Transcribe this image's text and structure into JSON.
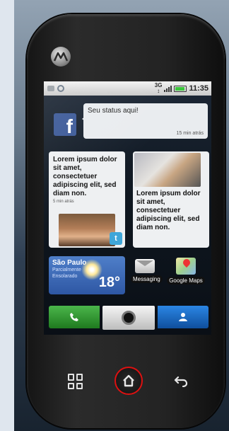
{
  "statusbar": {
    "network": "3G",
    "time": "11:35"
  },
  "facebook": {
    "icon_letter": "f",
    "status": "Seu status aqui!",
    "time": "15 min atrás"
  },
  "social": [
    {
      "text": "Lorem ipsum dolor sit amet, consectetuer adipiscing elit, sed diam non.",
      "time": "5 min atrás",
      "badge": "t"
    },
    {
      "text": "Lorem ipsum dolor sit amet, consectetuer adipiscing elit, sed diam non."
    }
  ],
  "weather": {
    "city": "São Paulo",
    "desc": "Parcialmente Ensolarado",
    "temp": "18°"
  },
  "apps": [
    {
      "label": "Messaging",
      "icon": "envelope-icon"
    },
    {
      "label": "Google Maps",
      "icon": "map-pin-icon"
    }
  ],
  "dock": {
    "call_icon": "phone-icon",
    "home_icon": "camera-dot-icon",
    "contacts_icon": "person-icon"
  },
  "colors": {
    "facebook": "#3b5998",
    "call": "#2e9a2e",
    "contacts": "#1d6fc8",
    "home_ring": "#d11111",
    "twitter": "#3fa6d9"
  }
}
